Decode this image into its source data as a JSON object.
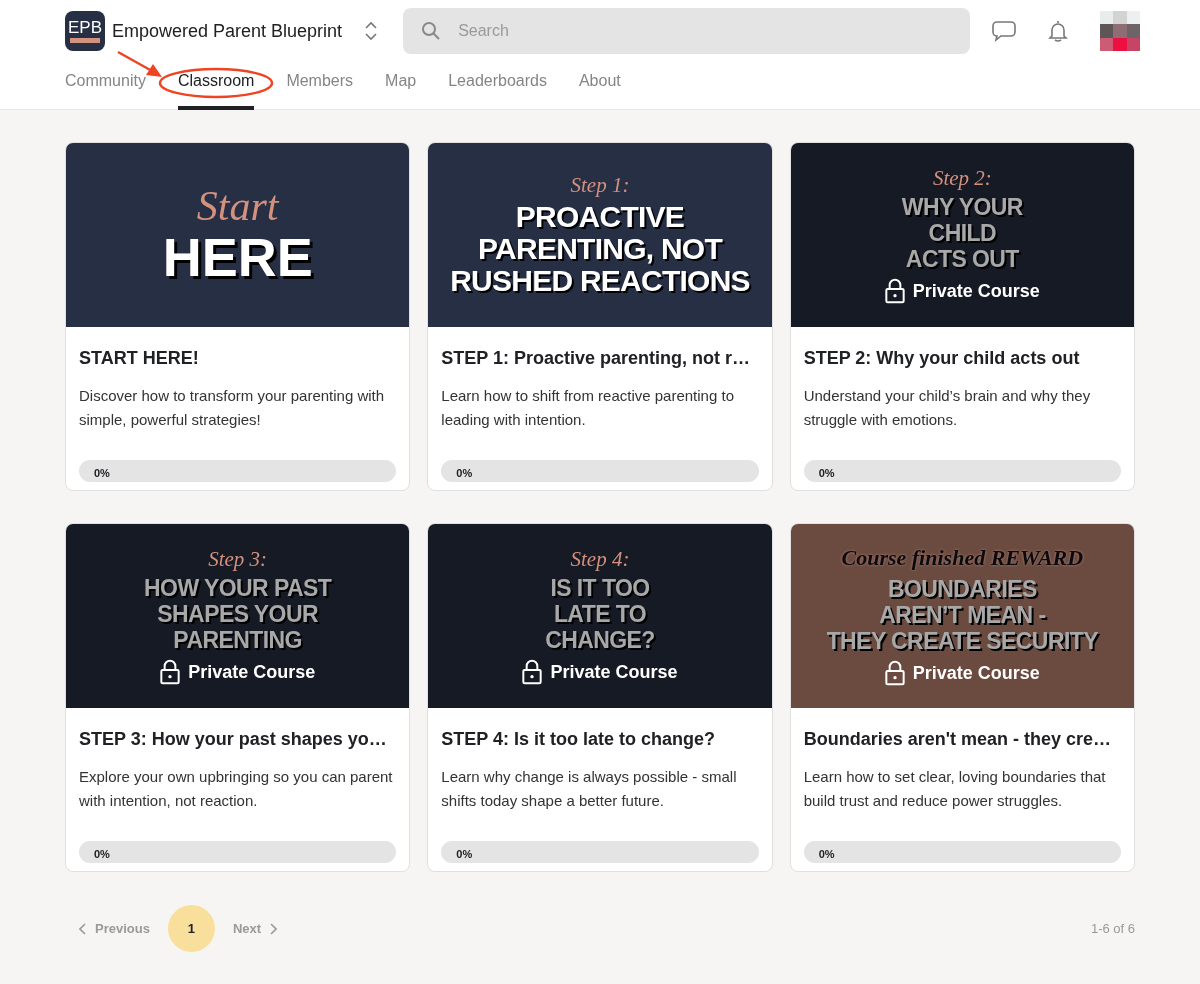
{
  "header": {
    "logo": "EPB",
    "title": "Empowered Parent Blueprint",
    "search": {
      "placeholder": "Search"
    }
  },
  "tabs": [
    {
      "label": "Community",
      "selected": false
    },
    {
      "label": "Classroom",
      "selected": true
    },
    {
      "label": "Members",
      "selected": false
    },
    {
      "label": "Map",
      "selected": false
    },
    {
      "label": "Leaderboards",
      "selected": false
    },
    {
      "label": "About",
      "selected": false
    }
  ],
  "courses": [
    {
      "cover": {
        "kind": "intro",
        "color": "#272f45",
        "heading": "Start",
        "lines": [
          "HERE"
        ]
      },
      "locked": false,
      "title": "START HERE!",
      "description": "Discover how to transform your parenting with simple, powerful strategies!",
      "progress": {
        "level": 0,
        "reading": "0%"
      }
    },
    {
      "cover": {
        "kind": "step",
        "color": "#272f45",
        "heading": "Step 1:",
        "lines": [
          "PROACTIVE",
          "PARENTING, NOT",
          "RUSHED REACTIONS"
        ]
      },
      "locked": false,
      "title": "STEP 1: Proactive parenting, not r…",
      "description": "Learn how to shift from reactive parenting to leading with intention.",
      "progress": {
        "level": 0,
        "reading": "0%"
      }
    },
    {
      "cover": {
        "kind": "step",
        "color": "#161a24",
        "heading": "Step 2:",
        "lines": [
          "WHY YOUR",
          "CHILD",
          "ACTS OUT"
        ]
      },
      "locked": true,
      "lock_label": "Private Course",
      "title": "STEP 2: Why your child acts out",
      "description": "Understand your child’s brain and why they struggle with emotions.",
      "progress": {
        "level": 0,
        "reading": "0%"
      }
    },
    {
      "cover": {
        "kind": "step",
        "color": "#161a24",
        "heading": "Step 3:",
        "lines": [
          "HOW YOUR PAST",
          "SHAPES YOUR",
          "PARENTING"
        ]
      },
      "locked": true,
      "lock_label": "Private Course",
      "title": "STEP 3: How your past shapes yo…",
      "description": "Explore your own upbringing so you can parent with intention, not reaction.",
      "progress": {
        "level": 0,
        "reading": "0%"
      }
    },
    {
      "cover": {
        "kind": "step",
        "color": "#161a24",
        "heading": "Step 4:",
        "lines": [
          "IS IT TOO",
          "LATE TO",
          "CHANGE?"
        ]
      },
      "locked": true,
      "lock_label": "Private Course",
      "title": "STEP 4: Is it too late to change?",
      "description": "Learn why change is always possible - small shifts today shape a better future.",
      "progress": {
        "level": 0,
        "reading": "0%"
      }
    },
    {
      "cover": {
        "kind": "reward",
        "color": "#6b4a3f",
        "heading": "Course finished REWARD",
        "lines": [
          "BOUNDARIES",
          "AREN’T MEAN -",
          "THEY CREATE SECURITY"
        ]
      },
      "locked": true,
      "lock_label": "Private Course",
      "title": "Boundaries aren't mean - they cre…",
      "description": "Learn how to set clear, loving boundaries that build trust and reduce power struggles.",
      "progress": {
        "level": 0,
        "reading": "0%"
      }
    }
  ],
  "pagination": {
    "previous": {
      "label": "Previous",
      "disabled": true
    },
    "pages": [
      {
        "label": "1",
        "selected": true
      }
    ],
    "next": {
      "label": "Next",
      "disabled": true
    },
    "summary": "1-6 of 6"
  }
}
